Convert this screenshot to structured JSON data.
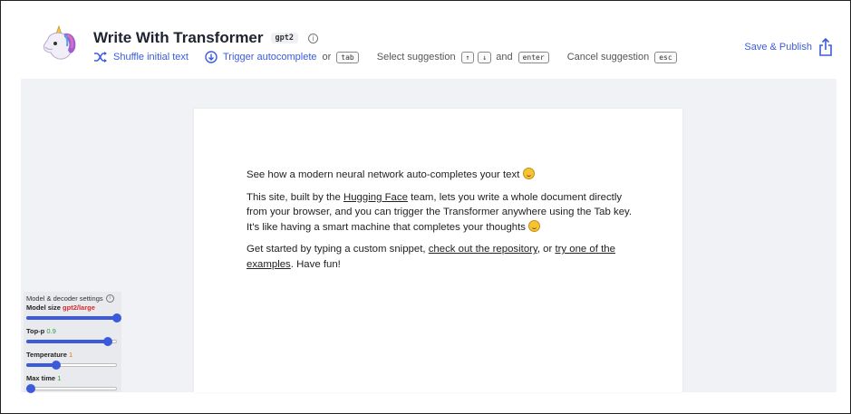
{
  "header": {
    "title": "Write With Transformer",
    "model_tag": "gpt2",
    "info_icon": "info-icon",
    "logo_icon": "unicorn-icon",
    "shuffle_label": "Shuffle initial text",
    "trigger_label": "Trigger autocomplete",
    "or_text": "or",
    "tab_key": "tab",
    "select_label": "Select suggestion",
    "up_key": "↑",
    "down_key": "↓",
    "and_text": "and",
    "enter_key": "enter",
    "cancel_label": "Cancel suggestion",
    "esc_key": "esc",
    "publish_label": "Save & Publish"
  },
  "document": {
    "p1": "See how a modern neural network auto-completes your text",
    "p2_a": "This site, built by the ",
    "p2_link": "Hugging Face",
    "p2_b": " team, lets you write a whole document directly from your browser, and you can trigger the Transformer anywhere using the Tab key. It's like having a smart machine that completes your thoughts",
    "p3_a": "Get started by typing a custom snippet, ",
    "p3_link1": "check out the repository",
    "p3_b": ", or ",
    "p3_link2": "try one of the examples",
    "p3_c": ". Have fun!"
  },
  "settings": {
    "title": "Model & decoder settings",
    "model_size_label": "Model size",
    "model_size_value": "gpt2/large",
    "model_size_level": 1.0,
    "top_p_label": "Top-p",
    "top_p_value": "0.9",
    "top_p_level": 0.9,
    "temperature_label": "Temperature",
    "temperature_value": "1",
    "temperature_level": 0.33,
    "max_time_label": "Max time",
    "max_time_value": "1",
    "max_time_level": 0.05
  },
  "colors": {
    "accent": "#3b5bdb",
    "workspace_bg": "#f1f2f5"
  }
}
